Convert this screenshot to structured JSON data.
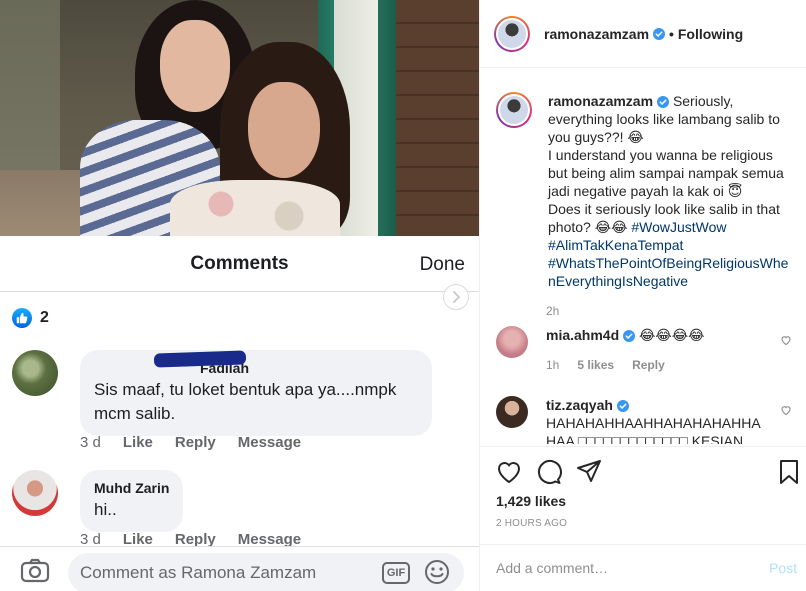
{
  "fb_comments": {
    "title": "Comments",
    "done_label": "Done",
    "likes_count": "2",
    "comments": [
      {
        "name": "Fadilah",
        "text_lines": [
          "Sis maaf,  tu loket bentuk apa ya....nmpk",
          "mcm salib."
        ],
        "time": "3 d",
        "like": "Like",
        "reply": "Reply",
        "message": "Message"
      },
      {
        "name": "Muhd Zarin",
        "text_lines": [
          "hi.."
        ],
        "time": "3 d",
        "like": "Like",
        "reply": "Reply",
        "message": "Message"
      }
    ],
    "input_placeholder": "Comment as Ramona Zamzam",
    "gif_label": "GIF"
  },
  "post": {
    "username": "ramonazamzam",
    "follow_status": "• Following",
    "caption_first": "Seriously,",
    "caption_lines": [
      "everything looks like lambang salib to",
      "you guys??! 😂",
      "I understand you wanna be religious",
      "but being alim sampai nampak semua",
      "jadi negative payah la kak oi 😇",
      "Does it seriously look like salib in that",
      "photo? 😂😂"
    ],
    "hashtag_inline": "#WowJustWow",
    "hashtags": [
      "#AlimTakKenaTempat",
      "#WhatsThePointOfBeingReligiousWhe",
      "nEverythingIsNegative"
    ],
    "caption_time": "2h",
    "comments": [
      {
        "username": "mia.ahm4d",
        "text": "😂😂😂😂",
        "time": "1h",
        "likes": "5 likes",
        "reply": "Reply"
      },
      {
        "username": "tiz.zaqyah",
        "text_lines": [
          "HAHAHAHHAAHHAHAHAHAHHA",
          "HAA □□□□□□□□□□□□□ KESIAN"
        ]
      }
    ],
    "likes_count": "1,429 likes",
    "post_age": "2 HOURS AGO",
    "add_comment_placeholder": "Add a comment…",
    "post_label": "Post"
  },
  "colors": {
    "fb_blue": "#1877f2",
    "hashtag": "#00376b",
    "muted": "#8e8e8e",
    "post_disabled": "#b2dffc",
    "verified": "#3897f0"
  }
}
